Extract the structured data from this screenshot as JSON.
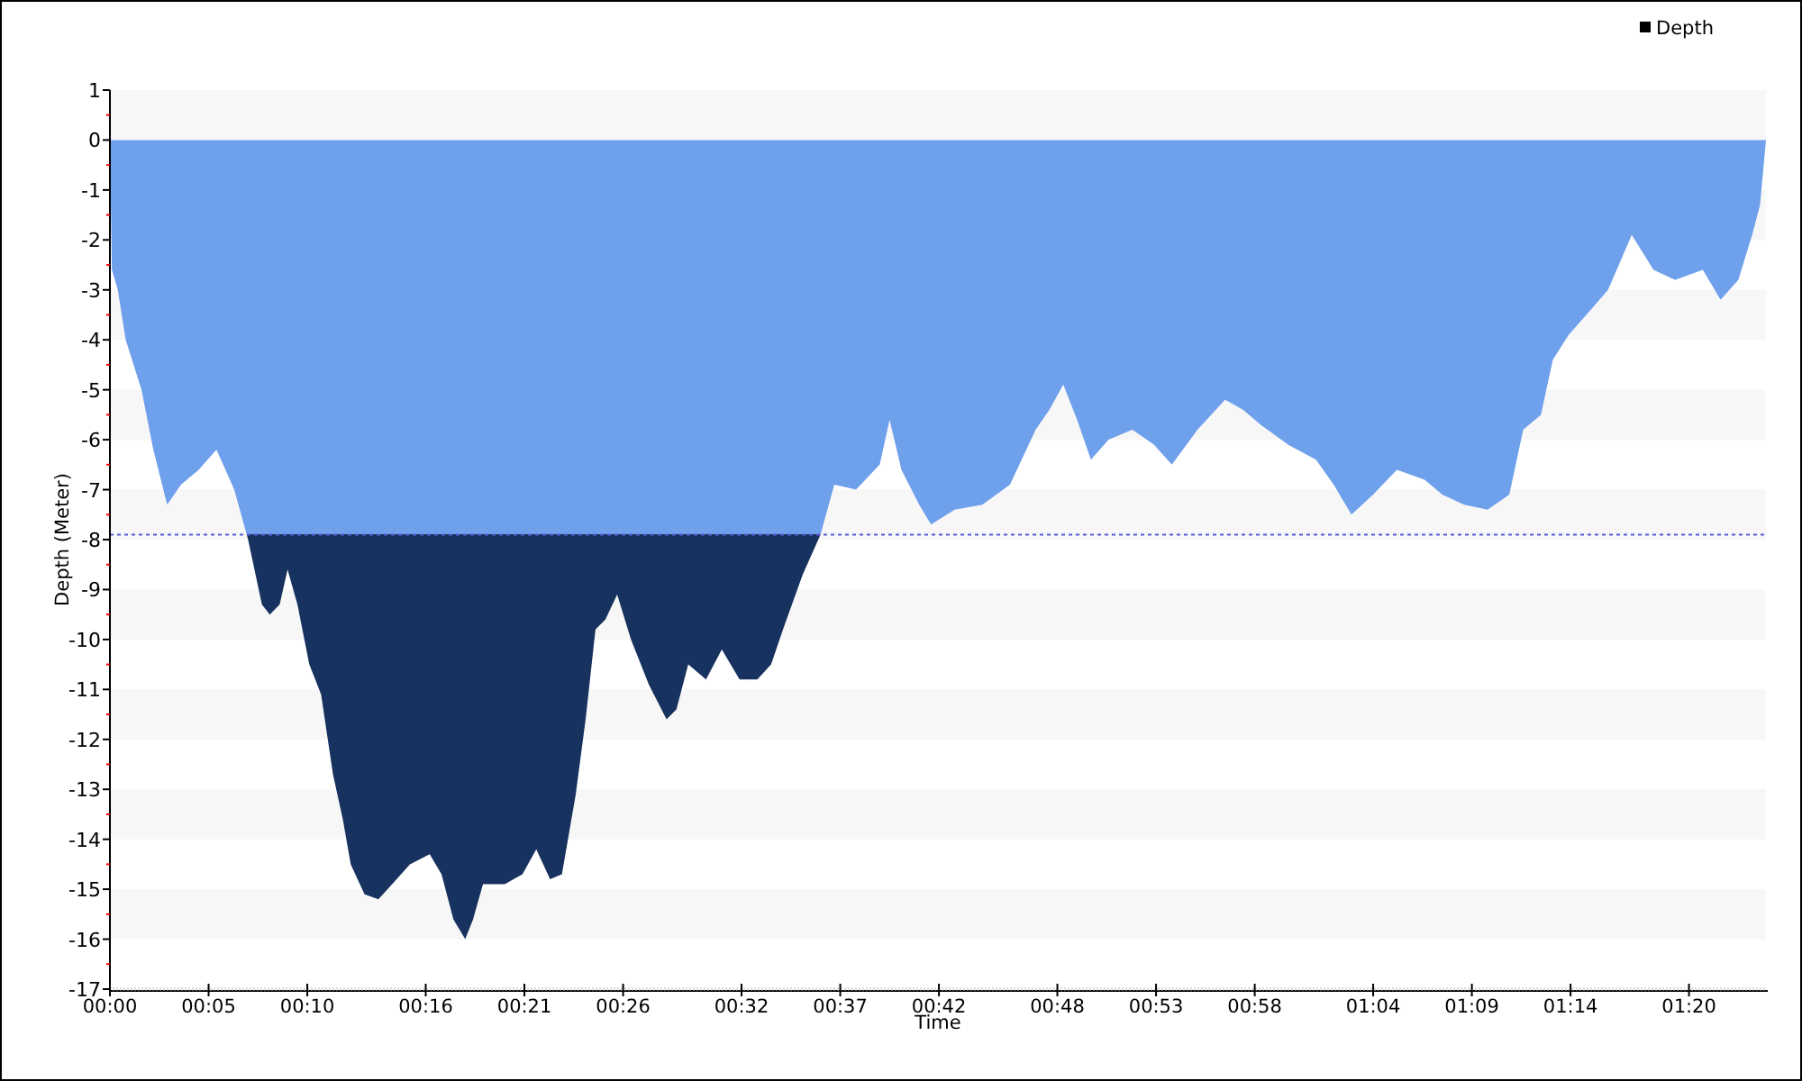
{
  "chart": {
    "chart_data": {
      "type": "area",
      "xlabel": "Time",
      "ylabel": "Depth (Meter)",
      "x": [
        0,
        0.1,
        0.4,
        0.8,
        1.6,
        2.2,
        2.9,
        3.6,
        4.5,
        5.4,
        6.3,
        7.0,
        7.7,
        8.1,
        8.6,
        9.0,
        9.5,
        10.1,
        10.7,
        11.3,
        11.8,
        12.2,
        12.9,
        13.6,
        14.3,
        15.2,
        16.2,
        16.8,
        17.4,
        18.0,
        18.4,
        18.9,
        20.0,
        20.9,
        21.6,
        22.3,
        22.9,
        23.6,
        24.1,
        24.6,
        25.1,
        25.7,
        26.4,
        27.3,
        28.2,
        28.7,
        29.3,
        30.2,
        31.0,
        31.9,
        32.8,
        33.5,
        34.1,
        35.1,
        36.0,
        36.7,
        37.8,
        39.0,
        39.5,
        40.1,
        41.0,
        41.6,
        42.8,
        44.2,
        45.6,
        46.9,
        47.6,
        48.3,
        49.0,
        49.7,
        50.6,
        51.8,
        52.9,
        53.8,
        55.1,
        56.5,
        57.4,
        58.3,
        59.7,
        61.1,
        62.0,
        62.9,
        64.0,
        65.2,
        66.6,
        67.5,
        68.6,
        69.8,
        70.9,
        71.6,
        72.5,
        73.1,
        73.9,
        74.8,
        75.9,
        77.1,
        78.2,
        79.3,
        80.7,
        81.6,
        82.5,
        83.2,
        83.6,
        83.9
      ],
      "series": [
        {
          "name": "Depth",
          "color": "#6fa0eb",
          "values": [
            0,
            -2.6,
            -3,
            -4,
            -5,
            -6.2,
            -7.3,
            -6.9,
            -6.6,
            -6.2,
            -7,
            -8,
            -9.3,
            -9.5,
            -9.3,
            -8.6,
            -9.3,
            -10.5,
            -11.1,
            -12.7,
            -13.6,
            -14.5,
            -15.1,
            -15.2,
            -14.9,
            -14.5,
            -14.3,
            -14.7,
            -15.6,
            -16,
            -15.6,
            -14.9,
            -14.9,
            -14.7,
            -14.2,
            -14.8,
            -14.7,
            -13.1,
            -11.6,
            -9.8,
            -9.6,
            -9.1,
            -10,
            -10.9,
            -11.6,
            -11.4,
            -10.5,
            -10.8,
            -10.2,
            -10.8,
            -10.8,
            -10.5,
            -9.8,
            -8.7,
            -7.9,
            -6.9,
            -7,
            -6.5,
            -5.6,
            -6.6,
            -7.3,
            -7.7,
            -7.4,
            -7.3,
            -6.9,
            -5.8,
            -5.4,
            -4.9,
            -5.6,
            -6.4,
            -6,
            -5.8,
            -6.1,
            -6.5,
            -5.8,
            -5.2,
            -5.4,
            -5.7,
            -6.1,
            -6.4,
            -6.9,
            -7.5,
            -7.1,
            -6.6,
            -6.8,
            -7.1,
            -7.3,
            -7.4,
            -7.1,
            -5.8,
            -5.5,
            -4.4,
            -3.9,
            -3.5,
            -3,
            -1.9,
            -2.6,
            -2.8,
            -2.6,
            -3.2,
            -2.8,
            -1.9,
            -1.3,
            0
          ]
        }
      ],
      "xlim": [
        0,
        83.9
      ],
      "ylim": [
        -17,
        1
      ],
      "xticks": [
        {
          "value": 0,
          "label": "00:00"
        },
        {
          "value": 5,
          "label": "00:05"
        },
        {
          "value": 10,
          "label": "00:10"
        },
        {
          "value": 16,
          "label": "00:16"
        },
        {
          "value": 21,
          "label": "00:21"
        },
        {
          "value": 26,
          "label": "00:26"
        },
        {
          "value": 32,
          "label": "00:32"
        },
        {
          "value": 37,
          "label": "00:37"
        },
        {
          "value": 42,
          "label": "00:42"
        },
        {
          "value": 48,
          "label": "00:48"
        },
        {
          "value": 53,
          "label": "00:53"
        },
        {
          "value": 58,
          "label": "00:58"
        },
        {
          "value": 64,
          "label": "01:04"
        },
        {
          "value": 69,
          "label": "01:09"
        },
        {
          "value": 74,
          "label": "01:14"
        },
        {
          "value": 80,
          "label": "01:20"
        }
      ],
      "yticks": [
        1,
        0,
        -1,
        -2,
        -3,
        -4,
        -5,
        -6,
        -7,
        -8,
        -9,
        -10,
        -11,
        -12,
        -13,
        -14,
        -15,
        -16,
        -17
      ],
      "ref_lines": [
        {
          "axis": "y",
          "value": -7.9,
          "color": "#5a5ad8"
        }
      ]
    }
  }
}
